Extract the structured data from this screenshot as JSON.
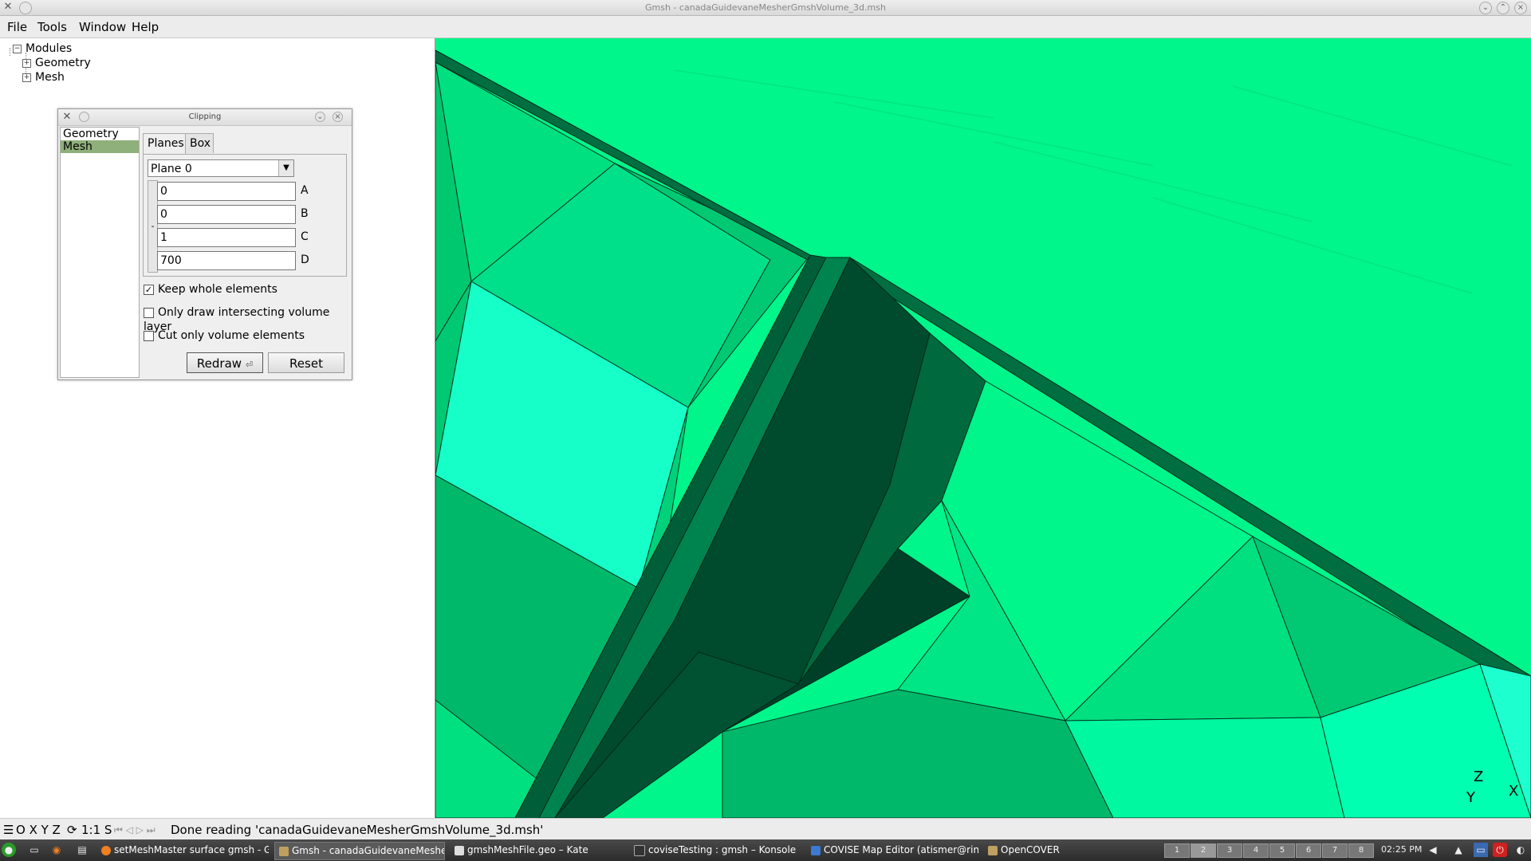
{
  "window": {
    "title": "Gmsh - canadaGuidevaneMesherGmshVolume_3d.msh"
  },
  "menubar": {
    "items": [
      {
        "label": "File"
      },
      {
        "label": "Tools"
      },
      {
        "label": "Window"
      },
      {
        "label": "Help"
      }
    ]
  },
  "tree": {
    "root": "Modules",
    "children": [
      "Geometry",
      "Mesh"
    ]
  },
  "clipping": {
    "title": "Clipping",
    "list": [
      "Geometry",
      "Mesh"
    ],
    "selected": "Mesh",
    "tabs": [
      "Planes",
      "Box"
    ],
    "plane_select": "Plane 0",
    "coefficients": [
      {
        "label": "A",
        "value": "0"
      },
      {
        "label": "B",
        "value": "0"
      },
      {
        "label": "C",
        "value": "1"
      },
      {
        "label": "D",
        "value": "700"
      }
    ],
    "side_button": "-",
    "checkboxes": [
      {
        "label": "Keep whole elements",
        "checked": true
      },
      {
        "label": "Only draw intersecting volume layer",
        "checked": false
      },
      {
        "label": "Cut only volume elements",
        "checked": false
      }
    ],
    "redraw_label": "Redraw",
    "reset_label": "Reset"
  },
  "viewport": {
    "background_color": "#00f58a",
    "axes": {
      "z": "Z",
      "x": "X",
      "y": "Y"
    }
  },
  "statusbar": {
    "left_controls": "O X Y Z",
    "scale": "1:1 S",
    "message": "Done reading 'canadaGuidevaneMesherGmshVolume_3d.msh'"
  },
  "taskbar": {
    "tasks": [
      {
        "label": "setMeshMaster surface gmsh - G"
      },
      {
        "label": "Gmsh - canadaGuidevaneMesher"
      },
      {
        "label": "gmshMeshFile.geo – Kate"
      },
      {
        "label": "coviseTesting : gmsh – Konsole"
      },
      {
        "label": "COVISE Map Editor (atismer@ring"
      },
      {
        "label": "OpenCOVER"
      }
    ],
    "pager": [
      "1",
      "2",
      "3",
      "4",
      "5",
      "6",
      "7",
      "8"
    ],
    "clock": "02:25 PM"
  }
}
